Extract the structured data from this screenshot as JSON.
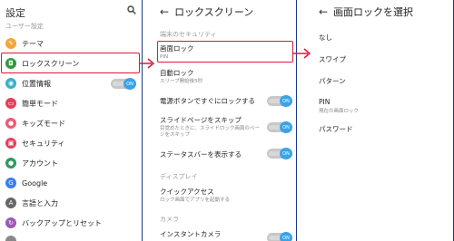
{
  "screen1": {
    "title": "設定",
    "section_user": "ユーザー設定",
    "items": [
      {
        "label": "テーマ",
        "icon": "theme-icon",
        "color": "#f4a534"
      },
      {
        "label": "ロックスクリーン",
        "icon": "lock-screen-icon",
        "color": "#2e9a3e"
      },
      {
        "label": "位置情報",
        "icon": "location-icon",
        "color": "#37b1c6"
      },
      {
        "label": "簡単モード",
        "icon": "easy-mode-icon",
        "color": "#e2405d"
      },
      {
        "label": "キッズモード",
        "icon": "kids-mode-icon",
        "color": "#f05878"
      },
      {
        "label": "セキュリティ",
        "icon": "security-icon",
        "color": "#e2405d"
      },
      {
        "label": "アカウント",
        "icon": "account-icon",
        "color": "#2e9a5e"
      },
      {
        "label": "Google",
        "icon": "google-icon",
        "color": "#3a7df0"
      },
      {
        "label": "言語と入力",
        "icon": "language-icon",
        "color": "#666666"
      },
      {
        "label": "バックアップとリセット",
        "icon": "backup-icon",
        "color": "#9b59b6"
      }
    ],
    "location_toggle": "ON"
  },
  "screen2": {
    "title": "ロックスクリーン",
    "section_security": "端末のセキュリティ",
    "screen_lock": {
      "label": "画面ロック",
      "sub": "PIN"
    },
    "auto_lock": {
      "label": "自動ロック",
      "sub": "スリープ開始後5秒"
    },
    "power_lock": {
      "label": "電源ボタンですぐにロックする",
      "toggle": "ON"
    },
    "skip_slide": {
      "label": "スライドページをスキップ",
      "sub": "目覚めたときに、スライドロック画面のページをスキップ",
      "toggle": "ON"
    },
    "status_bar": {
      "label": "ステータスバーを表示する",
      "toggle": "ON"
    },
    "section_display": "ディスプレイ",
    "quick_access": {
      "label": "クイックアクセス",
      "sub": "ロック画面でアプリを起動する"
    },
    "section_camera": "カメラ",
    "instant_camera": {
      "label": "インスタントカメラ",
      "toggle": "ON"
    }
  },
  "screen3": {
    "title": "画面ロックを選択",
    "options": [
      {
        "label": "なし",
        "sub": ""
      },
      {
        "label": "スワイプ",
        "sub": ""
      },
      {
        "label": "パターン",
        "sub": ""
      },
      {
        "label": "PIN",
        "sub": "現在の画面ロック"
      },
      {
        "label": "パスワード",
        "sub": ""
      }
    ]
  },
  "colors": {
    "highlight": "#e0163a",
    "border": "#1a3a8a",
    "toggle_on": "#3aa3e8"
  }
}
